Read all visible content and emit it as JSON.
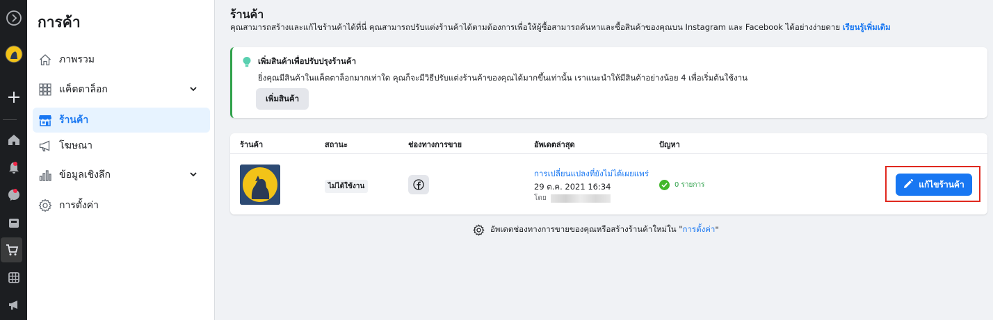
{
  "rail": {
    "icons": [
      "compass-icon",
      "profile-icon",
      "plus-icon",
      "home-icon",
      "bell-icon",
      "chat-icon",
      "pages-icon",
      "cart-icon",
      "grid-icon",
      "megaphone-icon"
    ]
  },
  "sidebar": {
    "title": "การค้า",
    "items": [
      {
        "label": "ภาพรวม",
        "icon": "home-outline-icon"
      },
      {
        "label": "แค็ตตาล็อก",
        "icon": "catalog-grid-icon"
      },
      {
        "label": "ร้านค้า",
        "icon": "storefront-icon"
      },
      {
        "label": "โฆษณา",
        "icon": "megaphone-icon"
      },
      {
        "label": "ข้อมูลเชิงลึก",
        "icon": "bar-chart-icon"
      },
      {
        "label": "การตั้งค่า",
        "icon": "gear-icon"
      }
    ]
  },
  "main": {
    "title": "ร้านค้า",
    "subtitle": "คุณสามารถสร้างและแก้ไขร้านค้าได้ที่นี่ คุณสามารถปรับแต่งร้านค้าได้ตามต้องการเพื่อให้ผู้ซื้อสามารถค้นหาและซื้อสินค้าของคุณบน Instagram และ Facebook ได้อย่างง่ายดาย",
    "learn_more": "เรียนรู้เพิ่มเติม"
  },
  "tip": {
    "title": "เพิ่มสินค้าเพื่อปรับปรุงร้านค้า",
    "body": "ยิ่งคุณมีสินค้าในแค็ตตาล็อกมากเท่าใด คุณก็จะมีวิธีปรับแต่งร้านค้าของคุณได้มากขึ้นเท่านั้น เราแนะนำให้มีสินค้าอย่างน้อย 4 เพื่อเริ่มต้นใช้งาน",
    "button": "เพิ่มสินค้า"
  },
  "table": {
    "headers": [
      "ร้านค้า",
      "สถานะ",
      "ช่องทางการขาย",
      "อัพเดตล่าสุด",
      "ปัญหา"
    ],
    "row": {
      "status": "ไม่ได้ใช้งาน",
      "channel_icon": "facebook-icon",
      "update_link": "การเปลี่ยนแปลงที่ยังไม่ได้เผยแพร่",
      "update_date": "29 ต.ค. 2021 16:34",
      "update_by": "โดย",
      "issues": "0 รายการ",
      "edit_button": "แก้ไขร้านค้า"
    }
  },
  "footer": {
    "text": "อัพเดตช่องทางการขายของคุณหรือสร้างร้านค้าใหม่ใน \"",
    "link": "การตั้งค่า",
    "suffix": "\""
  },
  "colors": {
    "accent": "#1877f2",
    "success": "#31a24c",
    "highlight": "#e0281e"
  }
}
